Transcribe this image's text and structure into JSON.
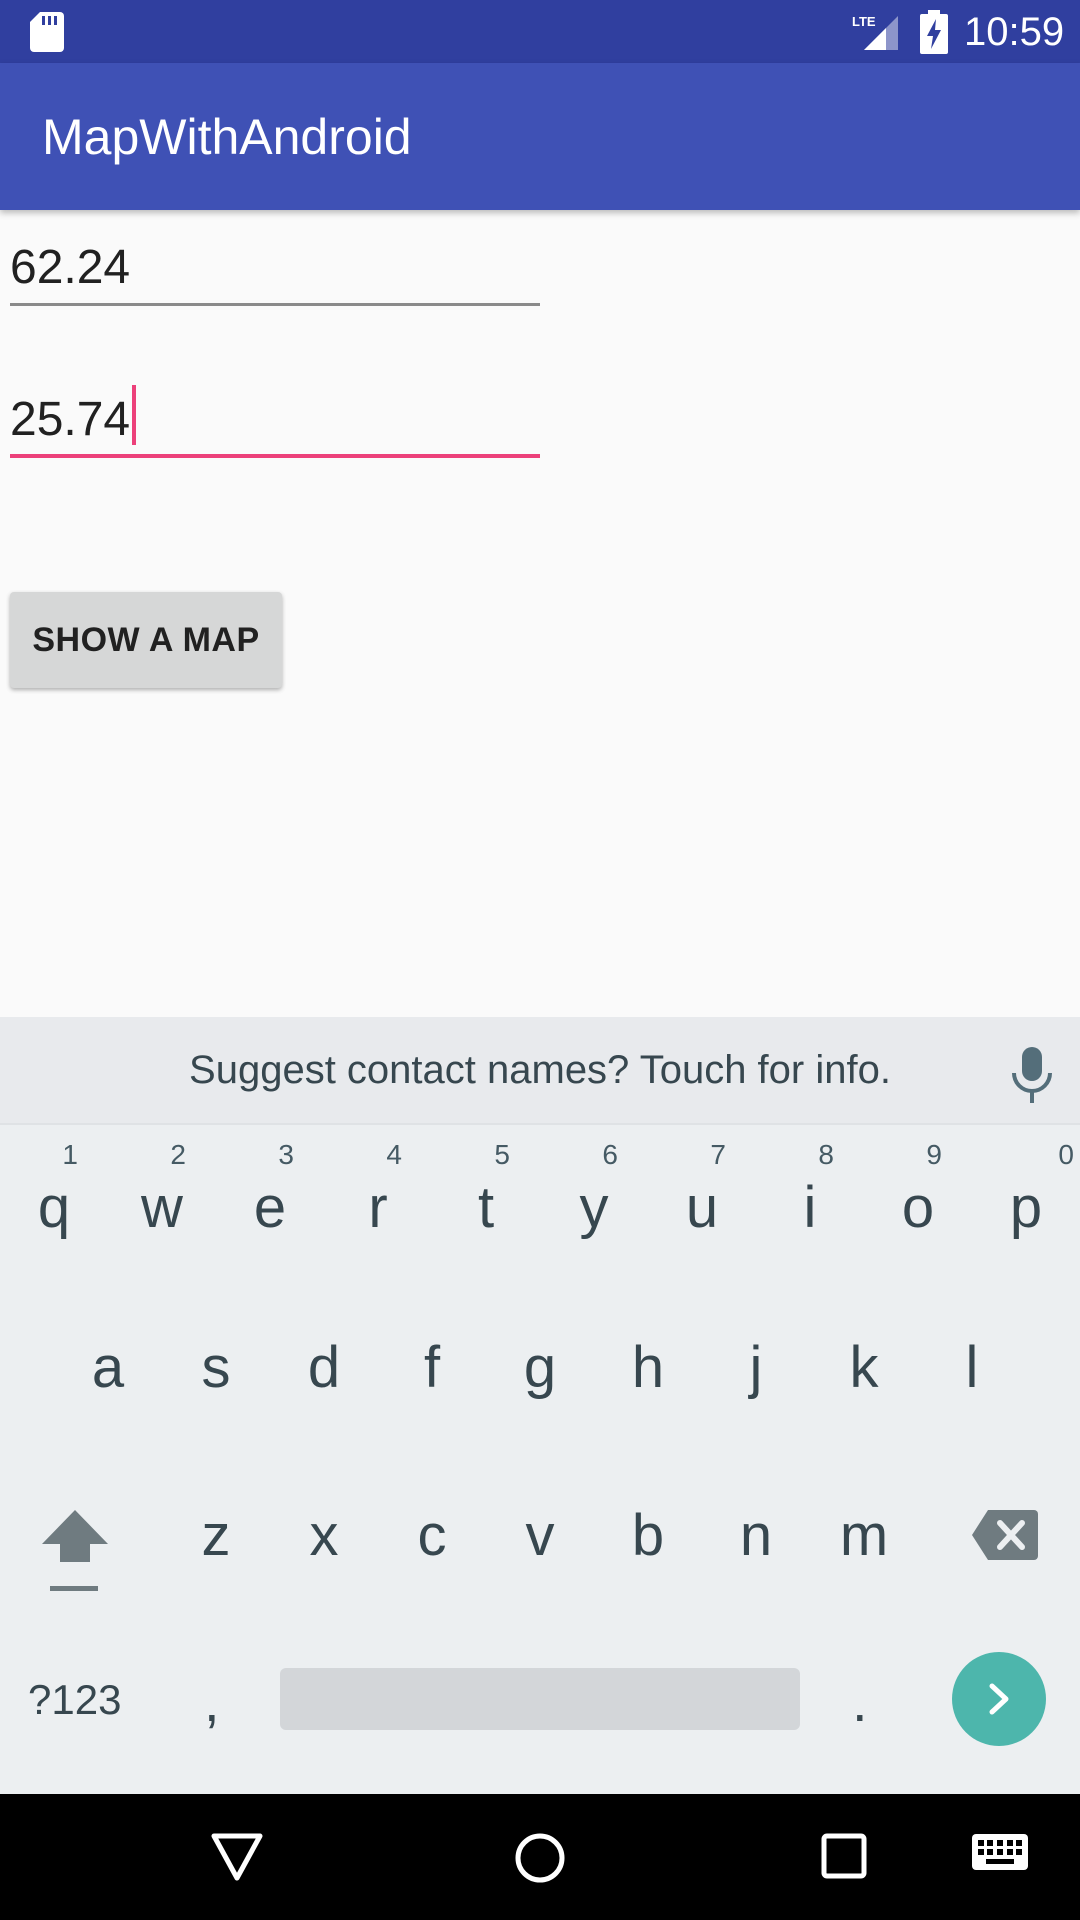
{
  "status_bar": {
    "time": "10:59",
    "network": "LTE",
    "icons": [
      "sd-card-icon",
      "lte-signal-icon",
      "battery-charging-icon"
    ]
  },
  "app_bar": {
    "title": "MapWithAndroid"
  },
  "form": {
    "latitude_value": "62.24",
    "longitude_value": "25.74",
    "show_map_label": "SHOW A MAP"
  },
  "keyboard": {
    "suggestion": "Suggest contact names? Touch for info.",
    "row1": [
      {
        "key": "q",
        "num": "1"
      },
      {
        "key": "w",
        "num": "2"
      },
      {
        "key": "e",
        "num": "3"
      },
      {
        "key": "r",
        "num": "4"
      },
      {
        "key": "t",
        "num": "5"
      },
      {
        "key": "y",
        "num": "6"
      },
      {
        "key": "u",
        "num": "7"
      },
      {
        "key": "i",
        "num": "8"
      },
      {
        "key": "o",
        "num": "9"
      },
      {
        "key": "p",
        "num": "0"
      }
    ],
    "row2": [
      "a",
      "s",
      "d",
      "f",
      "g",
      "h",
      "j",
      "k",
      "l"
    ],
    "row3": [
      "z",
      "x",
      "c",
      "v",
      "b",
      "n",
      "m"
    ],
    "symbols_label": "?123",
    "comma": ",",
    "period": "."
  },
  "colors": {
    "status_bar": "#303f9f",
    "app_bar": "#3f51b5",
    "accent": "#ec407a",
    "enter_key": "#4db6ac"
  }
}
